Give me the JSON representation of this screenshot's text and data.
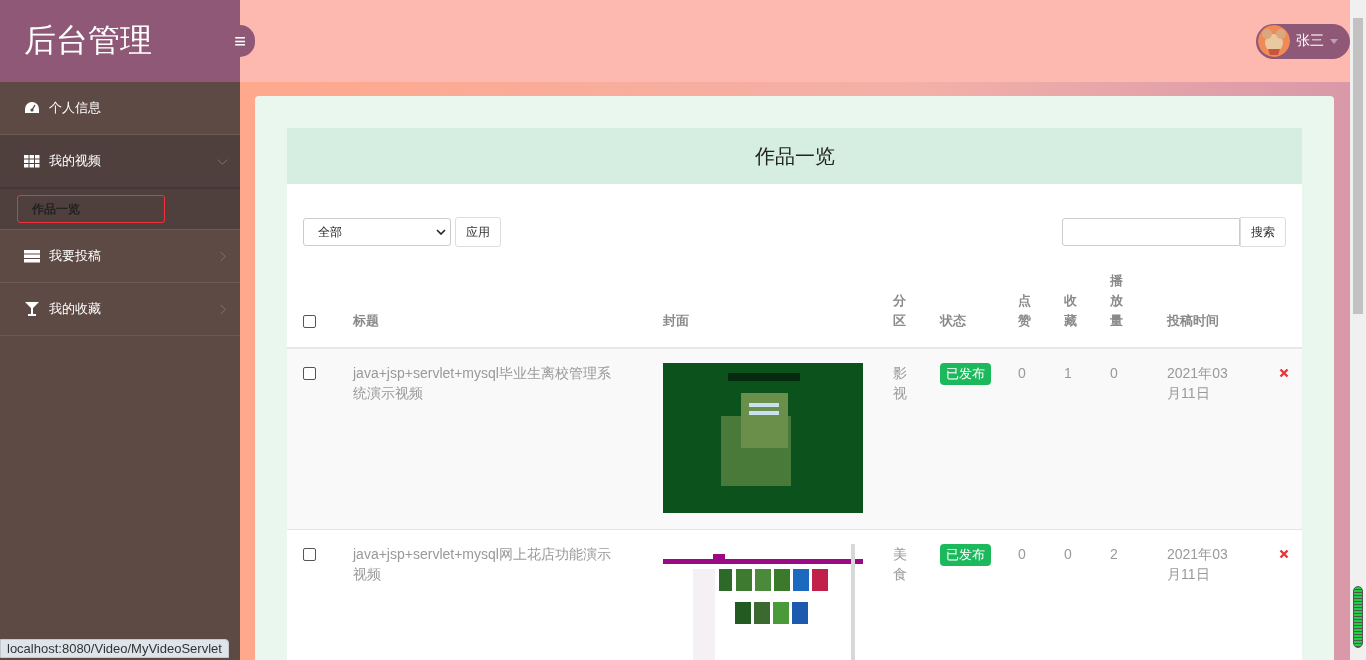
{
  "sidebar": {
    "logo": "后台管理",
    "toggle": "≡",
    "items": [
      {
        "label": "个人信息",
        "kind": "dashboard",
        "expandable": false,
        "expanded": false
      },
      {
        "label": "我的视频",
        "kind": "grid",
        "expandable": true,
        "expanded": true,
        "children": [
          {
            "label": "作品一览",
            "selected": true
          }
        ]
      },
      {
        "label": "我要投稿",
        "kind": "server",
        "expandable": true,
        "expanded": false
      },
      {
        "label": "我的收藏",
        "kind": "glass",
        "expandable": true,
        "expanded": false
      }
    ]
  },
  "header": {
    "user": "张三"
  },
  "page_title": "作品一览",
  "filter": {
    "value": "全部",
    "apply": "应用"
  },
  "search": {
    "button": "搜索"
  },
  "table": {
    "select_all": false,
    "columns": [
      "标题",
      "封面",
      "分区",
      "状态",
      "点赞",
      "收藏",
      "播放量",
      "投稿时间"
    ],
    "rows": [
      {
        "checked": false,
        "title": "java+jsp+servlet+mysql毕业生离校管理系统演示视频",
        "category": "影视",
        "status": "已发布",
        "likes": "0",
        "favorites": "1",
        "plays": "0",
        "date": "2021年03月11日"
      },
      {
        "checked": false,
        "title": "java+jsp+servlet+mysql网上花店功能演示视频",
        "category": "美食",
        "status": "已发布",
        "likes": "0",
        "favorites": "0",
        "plays": "2",
        "date": "2021年03月11日"
      }
    ]
  },
  "status_url": "localhost:8080/Video/MyVideoServlet"
}
